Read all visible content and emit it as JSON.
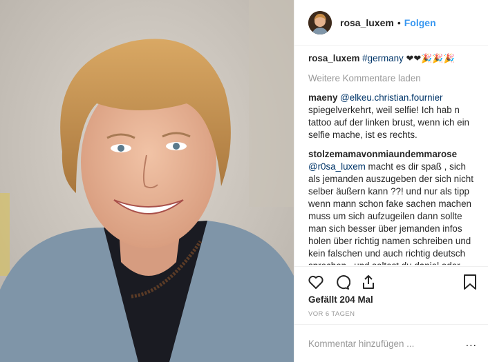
{
  "post": {
    "username": "rosa_luxem",
    "dot": "•",
    "follow_label": "Folgen",
    "caption_user": "rosa_luxem",
    "caption_tag": "#germany",
    "caption_emoji": "❤❤🎉🎉🎉"
  },
  "load_more_label": "Weitere Kommentare laden",
  "comments": [
    {
      "user": "maeny",
      "mention": "@elkeu.christian.fournier",
      "text": "spiegelverkehrt, weil selfie! Ich hab n tattoo auf der linken brust, wenn ich ein selfie mache, ist es rechts."
    },
    {
      "user": "stolzemamavonmiaundemmarose",
      "mention": "@r0sa_luxem",
      "text": "macht es dir spaß , sich als jemanden auszugeben der sich nicht selber äußern kann ??! und nur als tipp wenn mann schon fake sachen machen muss um sich aufzugeilen dann sollte man sich besser über jemanden infos holen über richtig namen schreiben und kein falschen und auch richtig deutsch sprechen , und soltest du daniel oder rosa sein stelle ein bild von dir rein ! macht es glaub würdiger aber so sich daraus ein spaß zu machen einfach nur"
    }
  ],
  "likes_label": "Gefällt 204 Mal",
  "time_label": "VOR 6 TAGEN",
  "comment_input": {
    "placeholder": "Kommentar hinzufügen ...",
    "value": ""
  },
  "more_label": "..."
}
